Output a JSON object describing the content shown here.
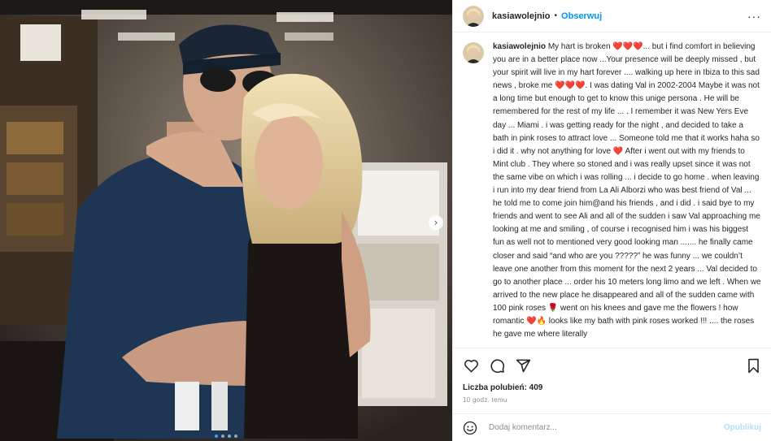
{
  "post": {
    "username": "kasiawolejnio",
    "separator": "•",
    "follow_label": "Obserwuj",
    "more_label": "···",
    "caption": "My hart is broken ❤️❤️❤️... but i find comfort in believing you are in a better place now ...Your presence will be deeply missed , but your spirit will live in my hart forever .... walking up here in Ibiza to this sad news , broke me ❤️❤️❤️. I was dating Val in 2002-2004 Maybe it was not a long time but enough to get to know this unige persona . He will be remembered for the rest of my life ... . I remember it was New Yers Eve day ... Miami . i was getting ready for the night , and decided to take a bath in pink roses to attract love ... Someone told me that it works haha so i did it . why not anything for love ❤️ After i went out with my friends to Mint club . They where so stoned and i was really upset since it was not the same vibe on which i was rolling ... i decide to go home . when leaving i run into my dear friend from La Ali Alborzi who was best friend of Val ... he told me to come join him@and his friends , and i did . i said bye to my friends and went to see Ali and all of the sudden i saw Val approaching me looking at me and smiling , of course i recognised him i was his biggest fun as well not to mentioned very good looking man ....... he finally came closer and said “and who are you ?????” he was funny ... we couldn’t leave one another from this moment for the next 2 years ... Val decided to go to another place ... order his 10 meters long limo and we left . When we arrived to the new place he disappeared and all of the sudden came with 100 pink roses 🌹 went on his knees and gave me the flowers ! how romantic ❤️🔥 looks like my bath with pink roses worked !!! .... the roses he gave me where literally",
    "likes_label": "Liczba polubień:",
    "likes_count": "409",
    "time_ago": "10 godz. temu",
    "comment_placeholder": "Dodaj komentarz...",
    "publish_label": "Opublikuj"
  },
  "carousel": {
    "slide_count": 4,
    "active_index": 0,
    "next_glyph": "›"
  },
  "icons": {
    "like": "heart-icon",
    "comment": "comment-icon",
    "share": "share-icon",
    "save": "bookmark-icon",
    "emoji": "smiley-icon",
    "next": "chevron-right-icon"
  },
  "colors": {
    "link": "#0095f6",
    "publish_disabled": "#b2dffc",
    "muted": "#8e8e8e",
    "text": "#262626",
    "dot_active": "#4aa0f0"
  }
}
